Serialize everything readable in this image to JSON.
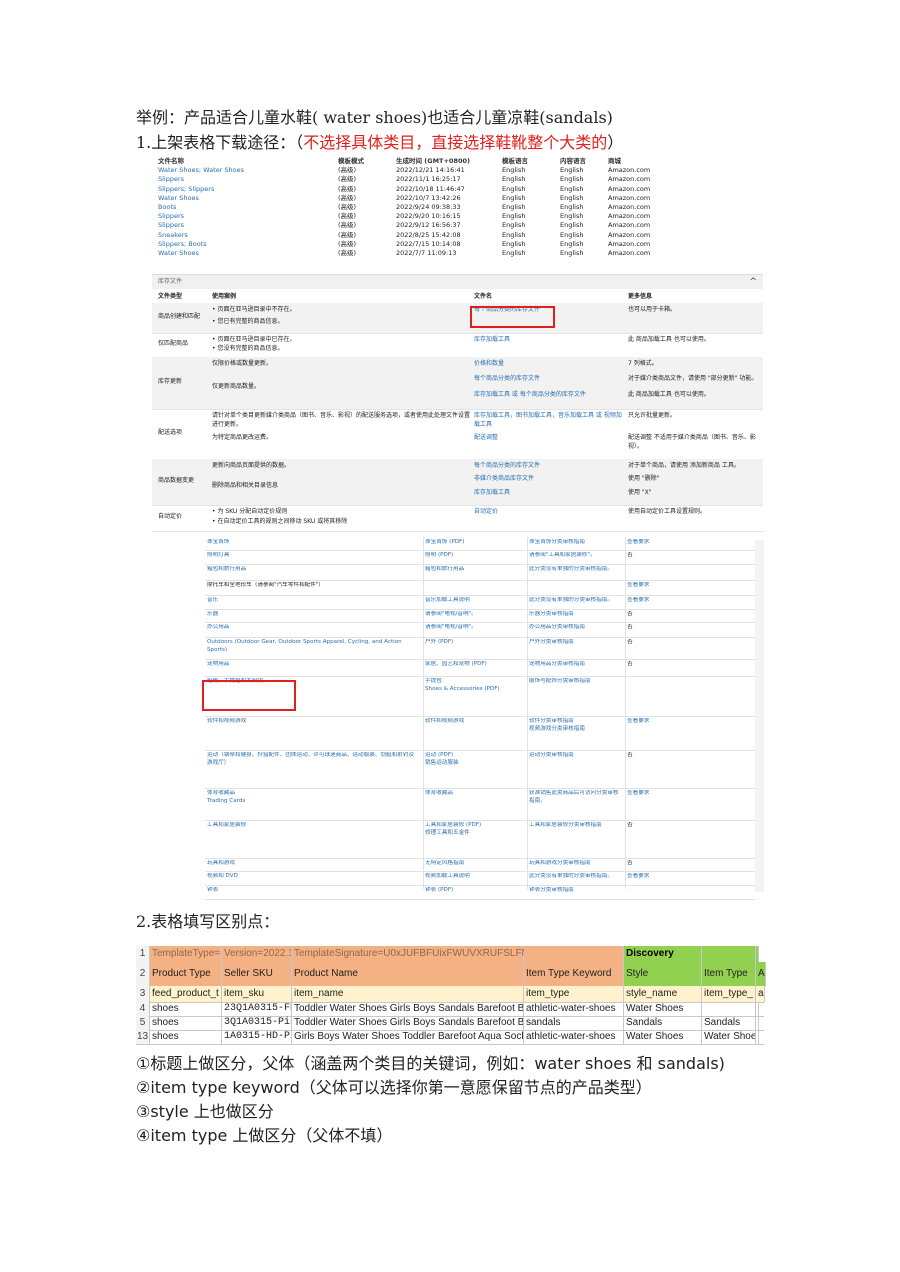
{
  "headings": {
    "example": "举例：产品适合儿童水鞋( water shoes)也适合儿童凉鞋(sandals)",
    "step1_prefix": "1.上架表格下载途径：（",
    "step1_red": "不选择具体类目，直接选择鞋靴整个大类的",
    "step1_suffix": "）",
    "step2": "2.表格填写区别点："
  },
  "download_table": {
    "headers": [
      "文件名称",
      "模板模式",
      "生成时间 (GMT+0800)",
      "模板语言",
      "内容语言",
      "商城"
    ],
    "rows": [
      [
        "Water Shoes; Water Shoes",
        "(高级)",
        "2022/12/21 14:16:41",
        "English",
        "English",
        "Amazon.com"
      ],
      [
        "Slippers",
        "(高级)",
        "2022/11/1 16:25:17",
        "English",
        "English",
        "Amazon.com"
      ],
      [
        "Slippers; Slippers",
        "(高级)",
        "2022/10/18 11:46:47",
        "English",
        "English",
        "Amazon.com"
      ],
      [
        "Water Shoes",
        "(高级)",
        "2022/10/7 13:42:26",
        "English",
        "English",
        "Amazon.com"
      ],
      [
        "Boots",
        "(高级)",
        "2022/9/24 09:38:33",
        "English",
        "English",
        "Amazon.com"
      ],
      [
        "Slippers",
        "(高级)",
        "2022/9/20 10:16:15",
        "English",
        "English",
        "Amazon.com"
      ],
      [
        "Slippers",
        "(高级)",
        "2022/9/12 16:56:37",
        "English",
        "English",
        "Amazon.com"
      ],
      [
        "Sneakers",
        "(高级)",
        "2022/8/25 15:42:08",
        "English",
        "English",
        "Amazon.com"
      ],
      [
        "Slippers; Boots",
        "(高级)",
        "2022/7/15 10:14:08",
        "English",
        "English",
        "Amazon.com"
      ],
      [
        "Water Shoes",
        "(高级)",
        "2022/7/7 11:09:13",
        "English",
        "English",
        "Amazon.com"
      ]
    ]
  },
  "inventory_panel": {
    "title": "库存文件",
    "caret": "^",
    "headers": [
      "文件类型",
      "使用案例",
      "文件名",
      "更多信息"
    ],
    "rows": [
      {
        "type": "商品创建和匹配",
        "uses": [
          "• 页面在亚马逊目录中不存在。",
          "• 您已有完整的商品信息。"
        ],
        "files": [
          "每个商品分类的库存文件"
        ],
        "info": [
          "也可以用于卡箱。"
        ]
      },
      {
        "type": "仅匹配商品",
        "uses": [
          "• 页面在亚马逊目录中已存在。",
          "• 您没有完整的商品信息。"
        ],
        "files": [
          "库存加载工具"
        ],
        "info": [
          "此 商品加载工具 也可以使用。"
        ]
      },
      {
        "type": "库存更新",
        "uses": [
          "仅限价格或数量更新。",
          "仅更新商品数量。"
        ],
        "files": [
          "价格和数量",
          "每个商品分类的库存文件",
          "库存加载工具 或 每个商品分类的库存文件"
        ],
        "info": [
          "7 列格式。",
          "对于媒介类商品文件，请使用 \"部分更新\" 功能。",
          "此 商品加载工具 也可以使用。"
        ]
      },
      {
        "type": "配送选项",
        "uses": [
          "请针对单个类目更新媒介类商品（图书、音乐、影视）的配送服务选项，或者使用此处理文件设置进行更新。",
          "为特定商品更改运费。"
        ],
        "files": [
          "库存加载工具，图书加载工具，音乐加载工具 或 视频加载工具",
          "配送调整"
        ],
        "info": [
          "只允许批量更新。",
          "配送调整 不适用于媒介类商品（图书、音乐、影视）。"
        ]
      },
      {
        "type": "商品数据变更",
        "uses": [
          "更新向商品页面提供的数据。",
          "删除商品和相关目录信息"
        ],
        "files": [
          "每个商品分类的库存文件",
          "非媒介类商品库存文件",
          "库存加载工具"
        ],
        "info": [
          "对于单个商品，请使用 添加新商品 工具。",
          "使用 \"删除\"",
          "使用 \"X\""
        ]
      },
      {
        "type": "自动定价",
        "uses": [
          "• 为 SKU 分配自动定价规则",
          "• 在自动定价工具的规则之间移动 SKU 或将其移除"
        ],
        "files": [
          "自动定价"
        ],
        "info": [
          "使用自动定价工具设置规则。"
        ]
      }
    ]
  },
  "category_table": {
    "rows": [
      [
        "珠宝首饰",
        "珠宝首饰 (PDF)",
        "珠宝首饰分类审核指南",
        "查看要求"
      ],
      [
        "照明灯具",
        "照明 (PDF)",
        "请参阅\"工具和家居装修\"。",
        "否"
      ],
      [
        "箱包和旅行用品",
        "箱包和旅行用品",
        "此分类没有单独的分类审核指南。",
        ""
      ],
      [
        "摩托车和全地形车（请参阅\"汽车零件和配件\"）",
        "",
        "",
        "查看要求"
      ],
      [
        "音乐",
        "音乐加载工具说明",
        "此分类没有单独的分类审核指南。",
        "查看要求"
      ],
      [
        "乐器",
        "请参阅\"电视/音响\"。",
        "乐器分类审核指南",
        "否"
      ],
      [
        "办公用品",
        "请参阅\"电视/音响\"。",
        "办公用品分类审核指南",
        "否"
      ],
      [
        "Outdoors (Outdoor Gear, Outdoor Sports Apparel, Cycling, and Action Sports)",
        "户外 (PDF)",
        "户外分类审核指南",
        "否"
      ],
      [
        "宠物用品",
        "家居、园艺和宠物 (PDF)",
        "宠物用品分类审核指南",
        "否"
      ],
      [
        "鞋靴、手提包和太阳镜",
        "手提包\nShoes & Accessories (PDF)",
        "服饰与配饰分类审核指南",
        ""
      ],
      [
        "软件和视频游戏",
        "软件和视频游戏",
        "软件分类审核指南\n视频游戏分类审核指南",
        "查看要求"
      ],
      [
        "运动（钢琴和健身、狩猎配件、团体运动、许可球迷商品、运动服装、划艇和射钓及游戏厅）",
        "运动 (PDF)\n销售运动服装",
        "运动分类审核指南",
        "否"
      ],
      [
        "体育收藏品\nTrading Cards",
        "体育收藏品",
        "获准销售此类商品后可访问分类审核指南。",
        "查看要求"
      ],
      [
        "工具和家居装修",
        "工具和家居装修 (PDF)\n修理工具和五金件",
        "工具和家居装修分类审核指南",
        "否"
      ],
      [
        "玩具和游戏",
        "无特定风格指南",
        "玩具和游戏分类审核指南",
        "否"
      ],
      [
        "视频和 DVD",
        "视频加载工具说明",
        "此分类没有单独的分类审核指南。",
        "查看要求"
      ],
      [
        "钟表",
        "钟表 (PDF)",
        "钟表分类审核指南",
        ""
      ]
    ]
  },
  "spreadsheet": {
    "col_letters_top": [
      "¹",
      "",
      "",
      "",
      "",
      "",
      "",
      "",
      ""
    ],
    "rows": [
      {
        "num": "1",
        "cells": [
          "TemplateType=",
          "Version=2022.1",
          "TemplateSignature=U0xJUFBFUixFWUVXRUFSLFNBTkRBTCxURUNITklDQU",
          "",
          "Discovery",
          "",
          ""
        ]
      },
      {
        "num": "2",
        "cells": [
          "Product Type",
          "Seller SKU",
          "Product Name",
          "Item Type Keyword",
          "Style",
          "Item Type",
          "A"
        ]
      },
      {
        "num": "3",
        "cells": [
          "feed_product_t",
          "item_sku",
          "item_name",
          "item_type",
          "style_name",
          "item_type_",
          "a"
        ]
      },
      {
        "num": "4",
        "cells": [
          "shoes",
          "23Q1A0315-FBA",
          "Toddler Water Shoes Girls Boys Sandals Barefoot Be",
          "athletic-water-shoes",
          "Water Shoes",
          "",
          ""
        ]
      },
      {
        "num": "5",
        "cells": [
          "shoes",
          "3Q1A0315-Pin",
          "Toddler Water Shoes Girls Boys Sandals Barefoot Be",
          "sandals",
          "Sandals",
          "Sandals",
          ""
        ]
      },
      {
        "num": "13",
        "cells": [
          "shoes",
          "1A0315-HD-Pi",
          "Girls Boys Water Shoes Toddler Barefoot Aqua Socks",
          "athletic-water-shoes",
          "Water Shoes",
          "Water Shoe",
          ""
        ]
      }
    ],
    "colors": {
      "header_orange": "#f4b183",
      "header_green": "#92d050",
      "row3_bg": "#fff2cc"
    }
  },
  "notes": [
    "①标题上做区分，父体（涵盖两个类目的关键词，例如：water shoes  和 sandals)",
    "②item type keyword（父体可以选择你第一意愿保留节点的产品类型）",
    "③style 上也做区分",
    "④item type 上做区分（父体不填）"
  ]
}
